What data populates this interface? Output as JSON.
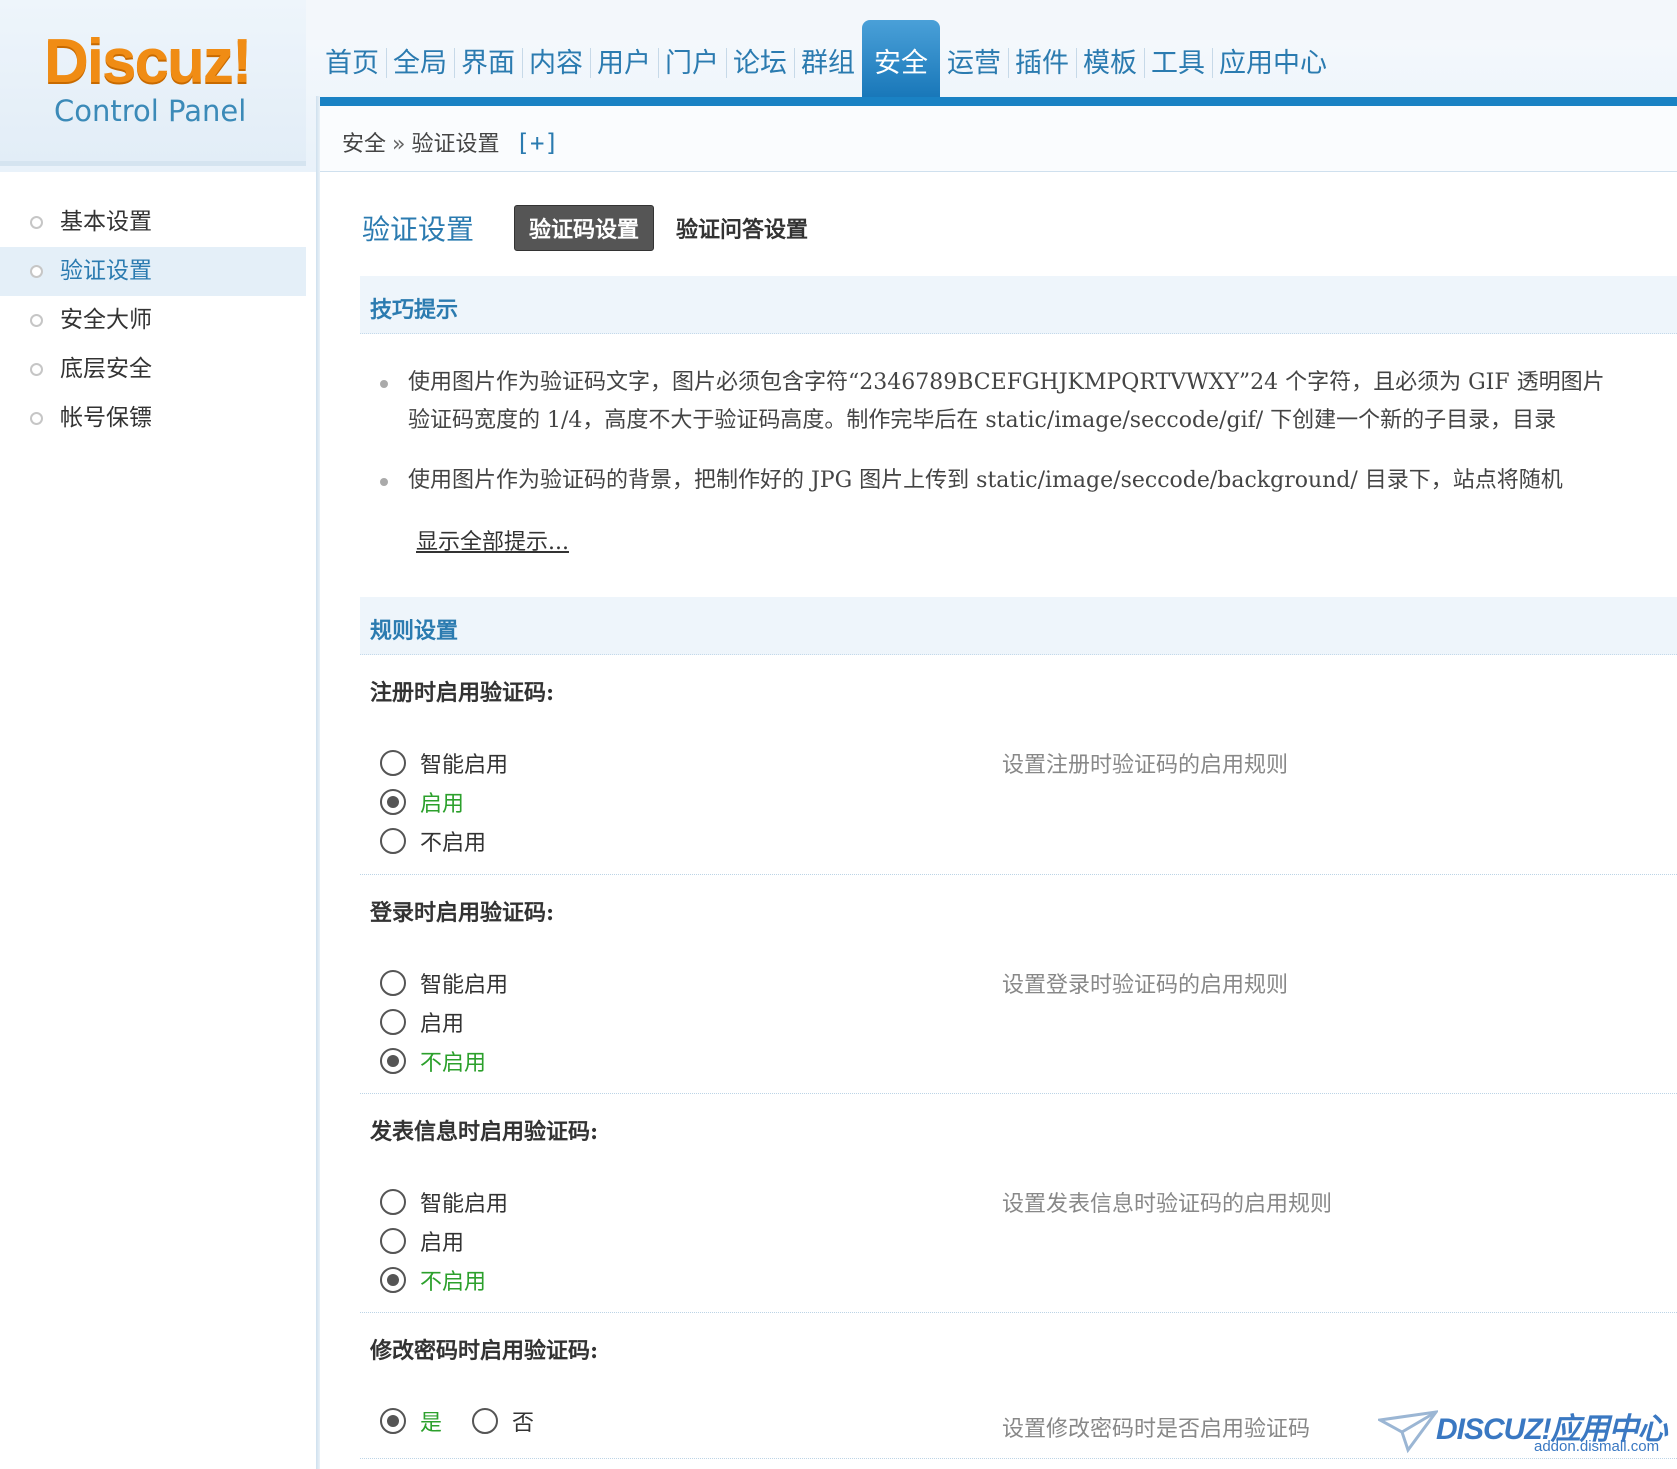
{
  "logo": {
    "main": "Discuz!",
    "sub": "Control Panel"
  },
  "nav": [
    {
      "label": "首页",
      "active": false
    },
    {
      "label": "全局",
      "active": false
    },
    {
      "label": "界面",
      "active": false
    },
    {
      "label": "内容",
      "active": false
    },
    {
      "label": "用户",
      "active": false
    },
    {
      "label": "门户",
      "active": false
    },
    {
      "label": "论坛",
      "active": false
    },
    {
      "label": "群组",
      "active": false
    },
    {
      "label": "安全",
      "active": true
    },
    {
      "label": "运营",
      "active": false
    },
    {
      "label": "插件",
      "active": false
    },
    {
      "label": "模板",
      "active": false
    },
    {
      "label": "工具",
      "active": false
    },
    {
      "label": "应用中心",
      "active": false
    }
  ],
  "breadcrumb": {
    "parent": "安全",
    "separator": "»",
    "current": "验证设置",
    "toggle": "[+]"
  },
  "sidebar": {
    "items": [
      {
        "label": "基本设置",
        "active": false
      },
      {
        "label": "验证设置",
        "active": true
      },
      {
        "label": "安全大师",
        "active": false
      },
      {
        "label": "底层安全",
        "active": false
      },
      {
        "label": "帐号保镖",
        "active": false
      }
    ]
  },
  "page": {
    "title": "验证设置",
    "tabs": [
      {
        "label": "验证码设置",
        "active": true
      },
      {
        "label": "验证问答设置",
        "active": false
      }
    ]
  },
  "tips": {
    "title": "技巧提示",
    "items": [
      [
        "使用图片作为验证码文字，图片必须包含字符“2346789BCEFGHJKMPQRTVWXY”24 个字符，且必须为 GIF 透明图片",
        "验证码宽度的 1/4，高度不大于验证码高度。制作完毕后在 static/image/seccode/gif/ 下创建一个新的子目录，目录"
      ],
      [
        "使用图片作为验证码的背景，把制作好的 JPG 图片上传到 static/image/seccode/background/ 目录下，站点将随机"
      ]
    ],
    "show_all": "显示全部提示..."
  },
  "rules": {
    "title": "规则设置",
    "register": {
      "label": "注册时启用验证码:",
      "options": [
        "智能启用",
        "启用",
        "不启用"
      ],
      "selected": 1,
      "desc": "设置注册时验证码的启用规则"
    },
    "login": {
      "label": "登录时启用验证码:",
      "options": [
        "智能启用",
        "启用",
        "不启用"
      ],
      "selected": 2,
      "desc": "设置登录时验证码的启用规则"
    },
    "post": {
      "label": "发表信息时启用验证码:",
      "options": [
        "智能启用",
        "启用",
        "不启用"
      ],
      "selected": 2,
      "desc": "设置发表信息时验证码的启用规则"
    },
    "password": {
      "label": "修改密码时启用验证码:",
      "options": [
        "是",
        "否"
      ],
      "selected": 0,
      "desc": "设置修改密码时是否启用验证码"
    }
  },
  "watermark": {
    "logo": "DISCUZ!应用中心",
    "url": "addon.dismall.com"
  },
  "colors": {
    "accent": "#2b7bb0",
    "nav_active": "#1a82c4",
    "checked": "#2ca02c",
    "logo": "#f08c14"
  }
}
